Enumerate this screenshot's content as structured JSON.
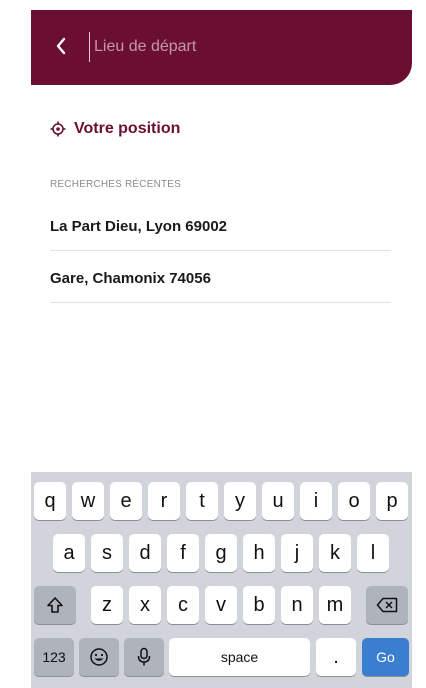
{
  "header": {
    "back_icon": "chevron-left-icon",
    "search_placeholder": "Lieu de départ",
    "accent_color": "#6b0f32"
  },
  "location": {
    "icon": "crosshair-icon",
    "label": "Votre position"
  },
  "recent": {
    "title": "RECHERCHES RÉCENTES",
    "items": [
      {
        "label": "La Part Dieu, Lyon 69002"
      },
      {
        "label": "Gare, Chamonix 74056"
      }
    ]
  },
  "keyboard": {
    "row1": [
      "q",
      "w",
      "e",
      "r",
      "t",
      "y",
      "u",
      "i",
      "o",
      "p"
    ],
    "row2": [
      "a",
      "s",
      "d",
      "f",
      "g",
      "h",
      "j",
      "k",
      "l"
    ],
    "row3": [
      "z",
      "x",
      "c",
      "v",
      "b",
      "n",
      "m"
    ],
    "numbers_label": "123",
    "space_label": "space",
    "period_label": ".",
    "go_label": "Go",
    "shift_icon": "shift-icon",
    "delete_icon": "backspace-icon",
    "emoji_icon": "emoji-icon",
    "mic_icon": "microphone-icon"
  }
}
